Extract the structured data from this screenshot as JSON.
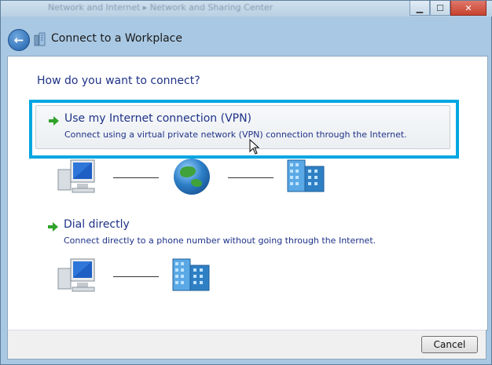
{
  "window": {
    "background_breadcrumb": "Network and Internet  ▸  Network and Sharing Center",
    "title": "Connect to a Workplace",
    "minimize_icon": "minimize-icon",
    "maximize_icon": "maximize-icon",
    "close_icon": "close-icon"
  },
  "main": {
    "question": "How do you want to connect?",
    "options": [
      {
        "title": "Use my Internet connection (VPN)",
        "description": "Connect using a virtual private network (VPN) connection through the Internet.",
        "highlighted": true
      },
      {
        "title": "Dial directly",
        "description": "Connect directly to a phone number without going through the Internet.",
        "highlighted": false
      }
    ]
  },
  "footer": {
    "cancel_label": "Cancel"
  },
  "colors": {
    "accent_highlight": "#00a6e2",
    "link_text": "#1e3287",
    "arrow": "#2fa32a"
  }
}
